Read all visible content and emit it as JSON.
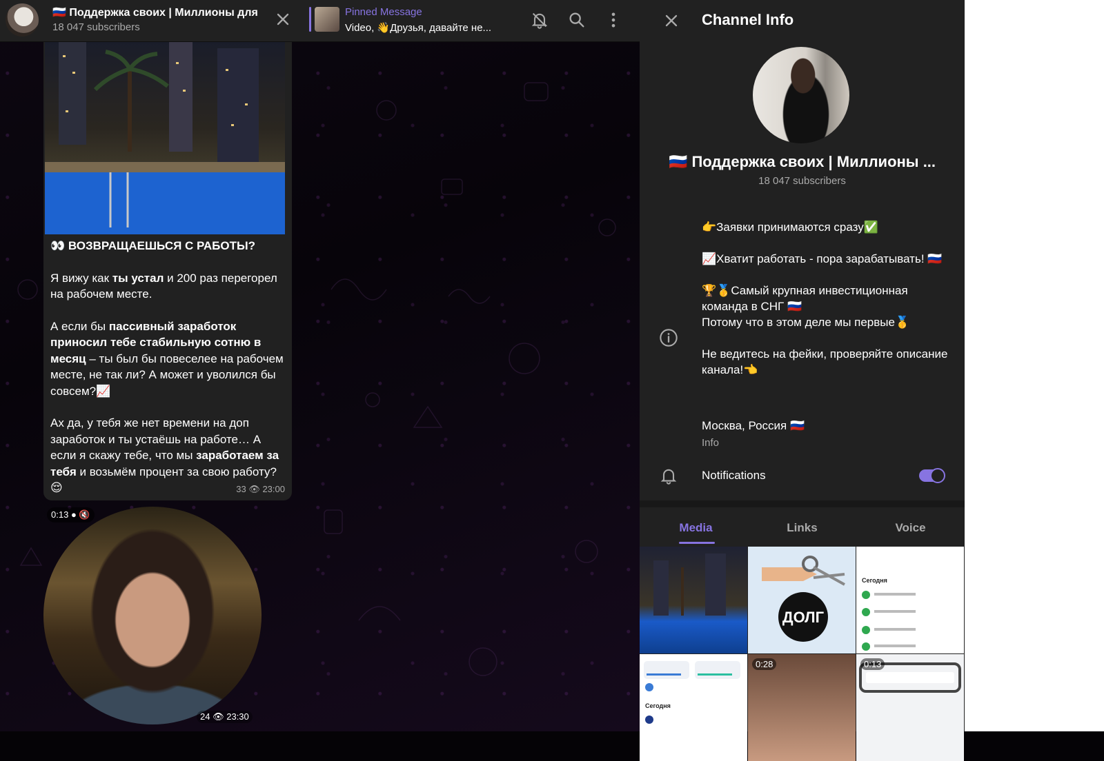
{
  "header": {
    "title": "🇷🇺 Поддержка своих | Миллионы для",
    "subscribers": "18 047 subscribers",
    "pinned_label": "Pinned Message",
    "pinned_text": "Video, 👋Друзья, давайте не..."
  },
  "message": {
    "paragraphs": [
      [
        {
          "t": "👀 ВОЗВРАЩАЕШЬСЯ С РАБОТЫ?",
          "b": true
        }
      ],
      [
        {
          "t": "Я вижу как ",
          "b": false
        },
        {
          "t": "ты устал",
          "b": true
        },
        {
          "t": " и 200 раз перегорел на рабочем месте.",
          "b": false
        }
      ],
      [
        {
          "t": "А если бы ",
          "b": false
        },
        {
          "t": "пассивный заработок приносил тебе стабильную сотню в месяц",
          "b": true
        },
        {
          "t": " – ты был бы повеселее на рабочем месте, не так ли? А может и уволился бы совсем?📈",
          "b": false
        }
      ],
      [
        {
          "t": "Ах да, у тебя же нет времени на доп заработок и ты устаёшь на работе… А если я скажу тебе, что мы ",
          "b": false
        },
        {
          "t": "заработаем за тебя",
          "b": true
        },
        {
          "t": " и возьмём процент за свою работу?😌",
          "b": false
        }
      ]
    ],
    "views": "33",
    "time": "23:00"
  },
  "video_message": {
    "duration": "0:13",
    "views": "24",
    "time": "23:30"
  },
  "panel": {
    "title": "Channel Info",
    "name": "🇷🇺 Поддержка своих | Миллионы ...",
    "subscribers": "18 047 subscribers",
    "about": [
      "👉Заявки принимаются сразу✅",
      "📈Хватит работать - пора зарабатывать! 🇷🇺",
      "🏆🥇Самый крупная инвестиционная команда в СНГ 🇷🇺\nПотому что в этом деле мы первые🥇",
      "Не ведитесь на фейки, проверяйте описание канала!👈"
    ],
    "location": "Москва, Россия 🇷🇺",
    "location_sub": "Info",
    "notifications_label": "Notifications",
    "notifications_on": true,
    "tabs": [
      "Media",
      "Links",
      "Voice"
    ],
    "active_tab": "Media",
    "media": [
      {
        "type": "photo",
        "icon": "city-pool-photo"
      },
      {
        "type": "image",
        "label": "ДОЛГ"
      },
      {
        "type": "screenshot",
        "label": "Сегодня"
      },
      {
        "type": "screenshot",
        "label": "Сегодня"
      },
      {
        "type": "video",
        "duration": "0:28"
      },
      {
        "type": "video",
        "duration": "0:13"
      }
    ]
  },
  "colors": {
    "accent": "#8774e1",
    "panel_bg": "#212121",
    "secondary_text": "#aaaaaa"
  }
}
